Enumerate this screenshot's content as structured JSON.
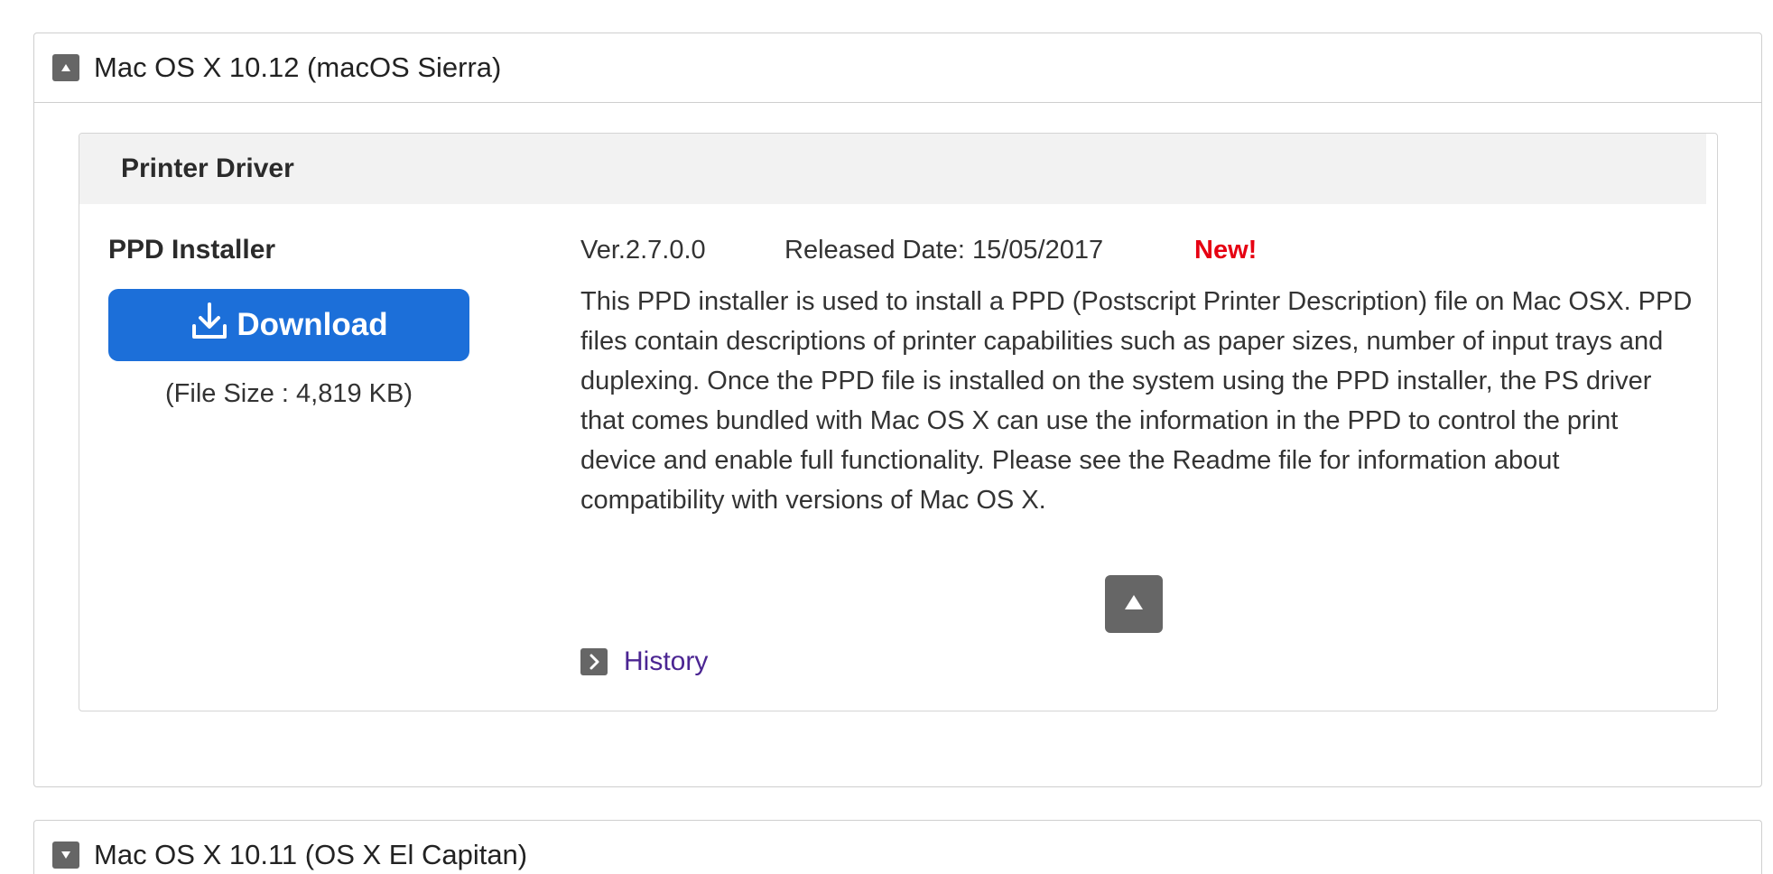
{
  "sections": [
    {
      "title": "Mac OS X 10.12 (macOS Sierra)",
      "expanded": true,
      "toggle_icon": "collapse-up-icon"
    },
    {
      "title": "Mac OS X 10.11 (OS X El Capitan)",
      "expanded": false,
      "toggle_icon": "expand-down-icon"
    }
  ],
  "driver_panel": {
    "category": "Printer Driver",
    "product_name": "PPD Installer",
    "download_label": "Download",
    "download_icon": "download-icon",
    "file_size": "(File Size : 4,819 KB)",
    "version": "Ver.2.7.0.0",
    "released_date": "Released Date: 15/05/2017",
    "new_badge": "New!",
    "description": "This PPD installer is used to install a PPD (Postscript Printer Description) file on Mac OSX. PPD files contain descriptions of printer capabilities such as paper sizes, number of input trays and duplexing. Once the PPD file is installed on the system using the PPD installer, the PS driver that comes bundled with Mac OS X can use the information in the PPD to control the print device and enable full functionality. Please see the Readme file for information about compatibility with versions of Mac OS X.",
    "scroll_top_icon": "triangle-up-icon",
    "history_label": "History",
    "history_icon": "chevron-right-icon"
  },
  "colors": {
    "download_button": "#1c6fd9",
    "new_badge": "#e60012",
    "history_link": "#4b2592",
    "icon_box": "#666666"
  }
}
